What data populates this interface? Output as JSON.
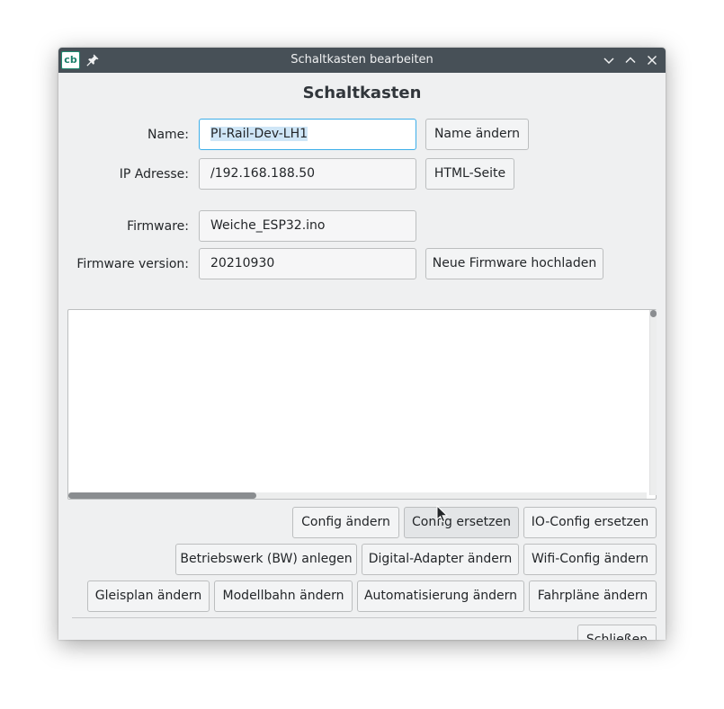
{
  "window": {
    "title": "Schaltkasten bearbeiten",
    "app_icon_text": "cb"
  },
  "heading": "Schaltkasten",
  "form": {
    "name_label": "Name:",
    "name_value_selected": "PI-Rail-Dev-LH1",
    "ip_label": "IP Adresse:",
    "ip_value": "/192.168.188.50",
    "firmware_label": "Firmware:",
    "firmware_value": "Weiche_ESP32.ino",
    "firmware_version_label": "Firmware version:",
    "firmware_version_value": "20210930"
  },
  "buttons": {
    "rename": "Name ändern",
    "html_page": "HTML-Seite",
    "upload_firmware": "Neue Firmware hochladen",
    "config_change": "Config ändern",
    "config_replace": "Config ersetzen",
    "io_config_replace": "IO-Config ersetzen",
    "create_depot": "Betriebswerk (BW) anlegen",
    "digital_adapter_change": "Digital-Adapter ändern",
    "wifi_config_change": "Wifi-Config ändern",
    "track_plan_change": "Gleisplan ändern",
    "model_railway_change": "Modellbahn ändern",
    "automation_change": "Automatisierung ändern",
    "timetables_change": "Fahrpläne ändern",
    "close": "Schließen"
  },
  "log_area": {
    "content": ""
  },
  "colors": {
    "titlebar": "#475057",
    "window_bg": "#eff0f1",
    "focus_accent": "#3daee9",
    "text": "#232629"
  },
  "icons": {
    "app": "cb-app-icon",
    "pin": "pin-icon",
    "minimize": "chevron-down-icon",
    "maximize": "chevron-up-icon",
    "close": "close-icon"
  }
}
